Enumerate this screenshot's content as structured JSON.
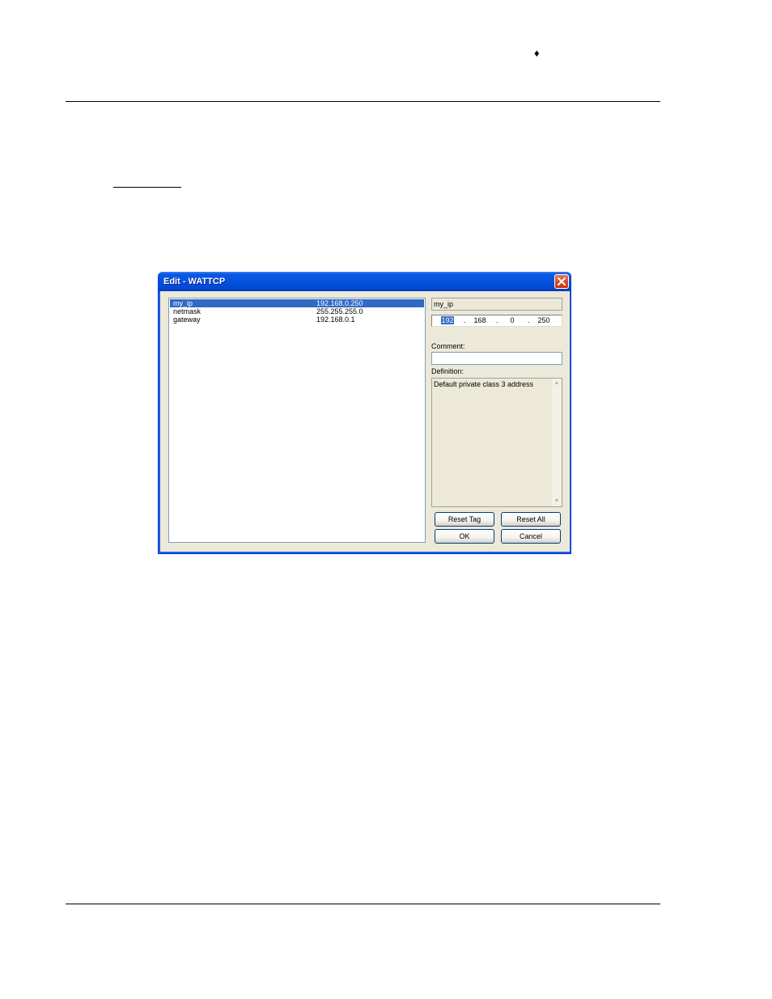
{
  "page": {
    "header_glyph": "♦"
  },
  "dialog": {
    "title": "Edit - WATTCP",
    "list": [
      {
        "name": "my_ip",
        "value": "192.168.0.250",
        "selected": true
      },
      {
        "name": "netmask",
        "value": "255.255.255.0",
        "selected": false
      },
      {
        "name": "gateway",
        "value": "192.168.0.1",
        "selected": false
      }
    ],
    "tag_name": "my_ip",
    "ip_octets": [
      "192",
      "168",
      "0",
      "250"
    ],
    "ip_separator": ".",
    "comment_label": "Comment:",
    "comment_value": "",
    "definition_label": "Definition:",
    "definition_text": "Default private class 3 address",
    "buttons": {
      "reset_tag": "Reset Tag",
      "reset_all": "Reset All",
      "ok": "OK",
      "cancel": "Cancel"
    }
  },
  "icons": {
    "close": "close-icon",
    "scroll_up": "scroll-up-arrow-icon",
    "scroll_down": "scroll-down-arrow-icon"
  },
  "colors": {
    "titlebar": "#0553de",
    "selection": "#316ac5",
    "dialog_bg": "#ece9d8",
    "close_button": "#d6471f"
  }
}
